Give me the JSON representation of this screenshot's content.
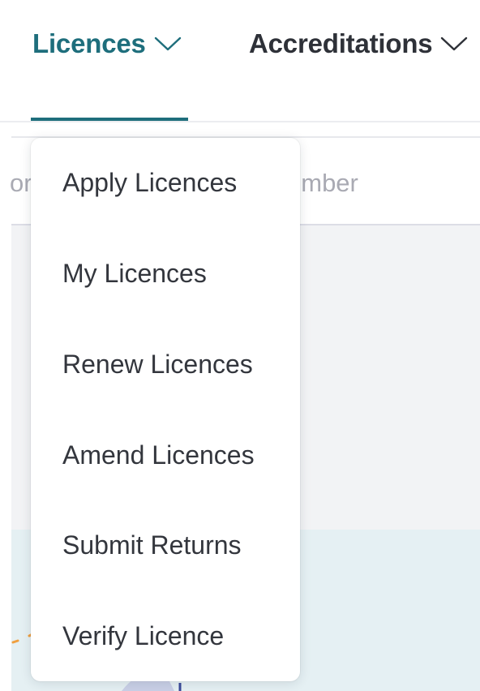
{
  "nav": {
    "items": [
      {
        "label": "Licences",
        "icon": "chevron-down-icon",
        "active": true
      },
      {
        "label": "Accreditations",
        "icon": "chevron-down-icon",
        "active": false
      }
    ],
    "active_color": "#1e6e7c",
    "text_color": "#2e3138"
  },
  "background": {
    "search_fragment_left": "or",
    "search_fragment_right": "umber",
    "grey_panel_color": "#f2f3f5",
    "teal_panel_color": "#e5f0f3"
  },
  "dropdown": {
    "items": [
      {
        "label": "Apply Licences"
      },
      {
        "label": "My Licences"
      },
      {
        "label": "Renew Licences"
      },
      {
        "label": "Amend Licences"
      },
      {
        "label": "Submit Returns"
      },
      {
        "label": "Verify Licence"
      }
    ]
  }
}
